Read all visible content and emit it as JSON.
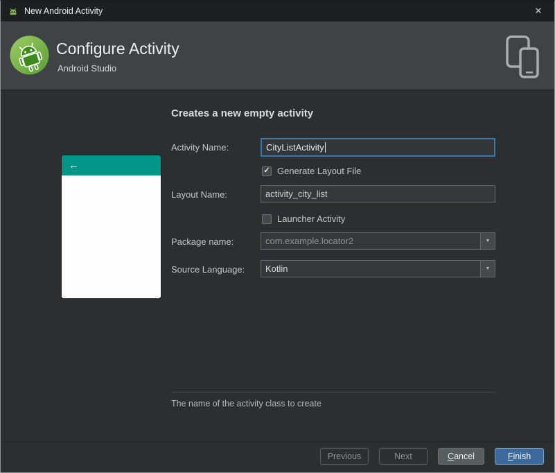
{
  "window": {
    "title": "New Android Activity",
    "close_glyph": "✕"
  },
  "header": {
    "title": "Configure Activity",
    "subtitle": "Android Studio"
  },
  "content": {
    "heading": "Creates a new empty activity",
    "help_text": "The name of the activity class to create"
  },
  "form": {
    "activity_name": {
      "label": "Activity Name:",
      "value": "CityListActivity"
    },
    "generate_layout": {
      "label": "Generate Layout File",
      "checked": true
    },
    "layout_name": {
      "label": "Layout Name:",
      "value": "activity_city_list"
    },
    "launcher_activity": {
      "label": "Launcher Activity",
      "checked": false
    },
    "package_name": {
      "label": "Package name:",
      "value": "com.example.locator2"
    },
    "source_language": {
      "label": "Source Language:",
      "value": "Kotlin"
    }
  },
  "preview": {
    "back_arrow": "←"
  },
  "buttons": {
    "previous": "Previous",
    "next": "Next",
    "cancel": "Cancel",
    "finish": "Finish"
  },
  "icons": {
    "check": "✓",
    "dropdown": "▼"
  },
  "colors": {
    "teal": "#009688",
    "finish_bg": "#3c6a9d",
    "focus_border": "#3f74ab"
  }
}
